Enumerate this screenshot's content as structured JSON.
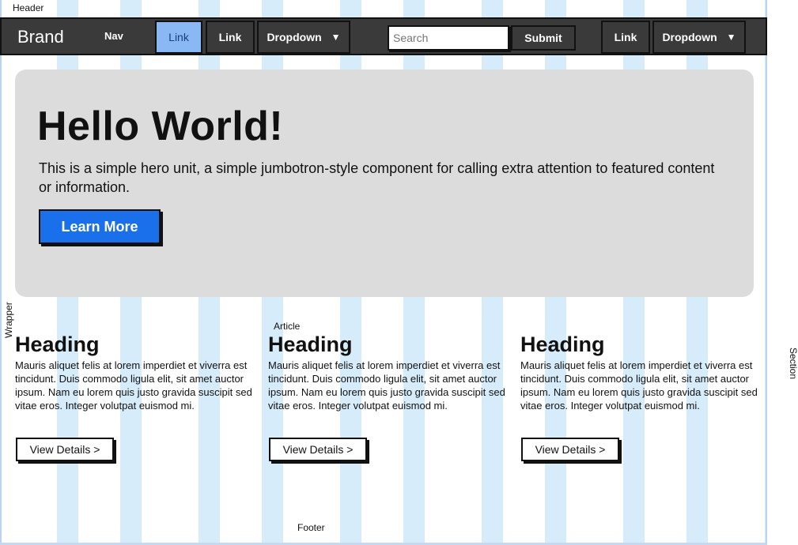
{
  "labels": {
    "header": "Header",
    "wrapper": "Wrapper",
    "article": "Article",
    "footer": "Footer",
    "section": "Section"
  },
  "navbar": {
    "brand": "Brand",
    "nav_text": "Nav",
    "link1": "Link",
    "link2": "Link",
    "dropdown1": "Dropdown",
    "search_placeholder": "Search",
    "submit": "Submit",
    "link3": "Link",
    "dropdown2": "Dropdown",
    "caret": "▼"
  },
  "hero": {
    "title": "Hello World!",
    "text": "This is a simple hero unit, a simple jumbotron-style component for calling extra attention to featured content or information.",
    "button": "Learn More",
    "button_color": "#1a6fea"
  },
  "columns": [
    {
      "heading": "Heading",
      "body": "Mauris aliquet felis at lorem imperdiet et viverra est tincidunt. Duis commodo ligula elit, sit amet auctor ipsum. Nam eu lorem quis justo gravida suscipit sed vitae eros. Integer volutpat euismod mi.",
      "button": "View Details >"
    },
    {
      "heading": "Heading",
      "body": "Mauris aliquet felis at lorem imperdiet et viverra est tincidunt. Duis commodo ligula elit, sit amet auctor ipsum. Nam eu lorem quis justo gravida suscipit sed vitae eros. Integer volutpat euismod mi.",
      "button": "View Details >"
    },
    {
      "heading": "Heading",
      "body": "Mauris aliquet felis at lorem imperdiet et viverra est tincidunt. Duis commodo ligula elit, sit amet auctor ipsum. Nam eu lorem quis justo gravida suscipit sed vitae eros. Integer volutpat euismod mi.",
      "button": "View Details >"
    }
  ]
}
